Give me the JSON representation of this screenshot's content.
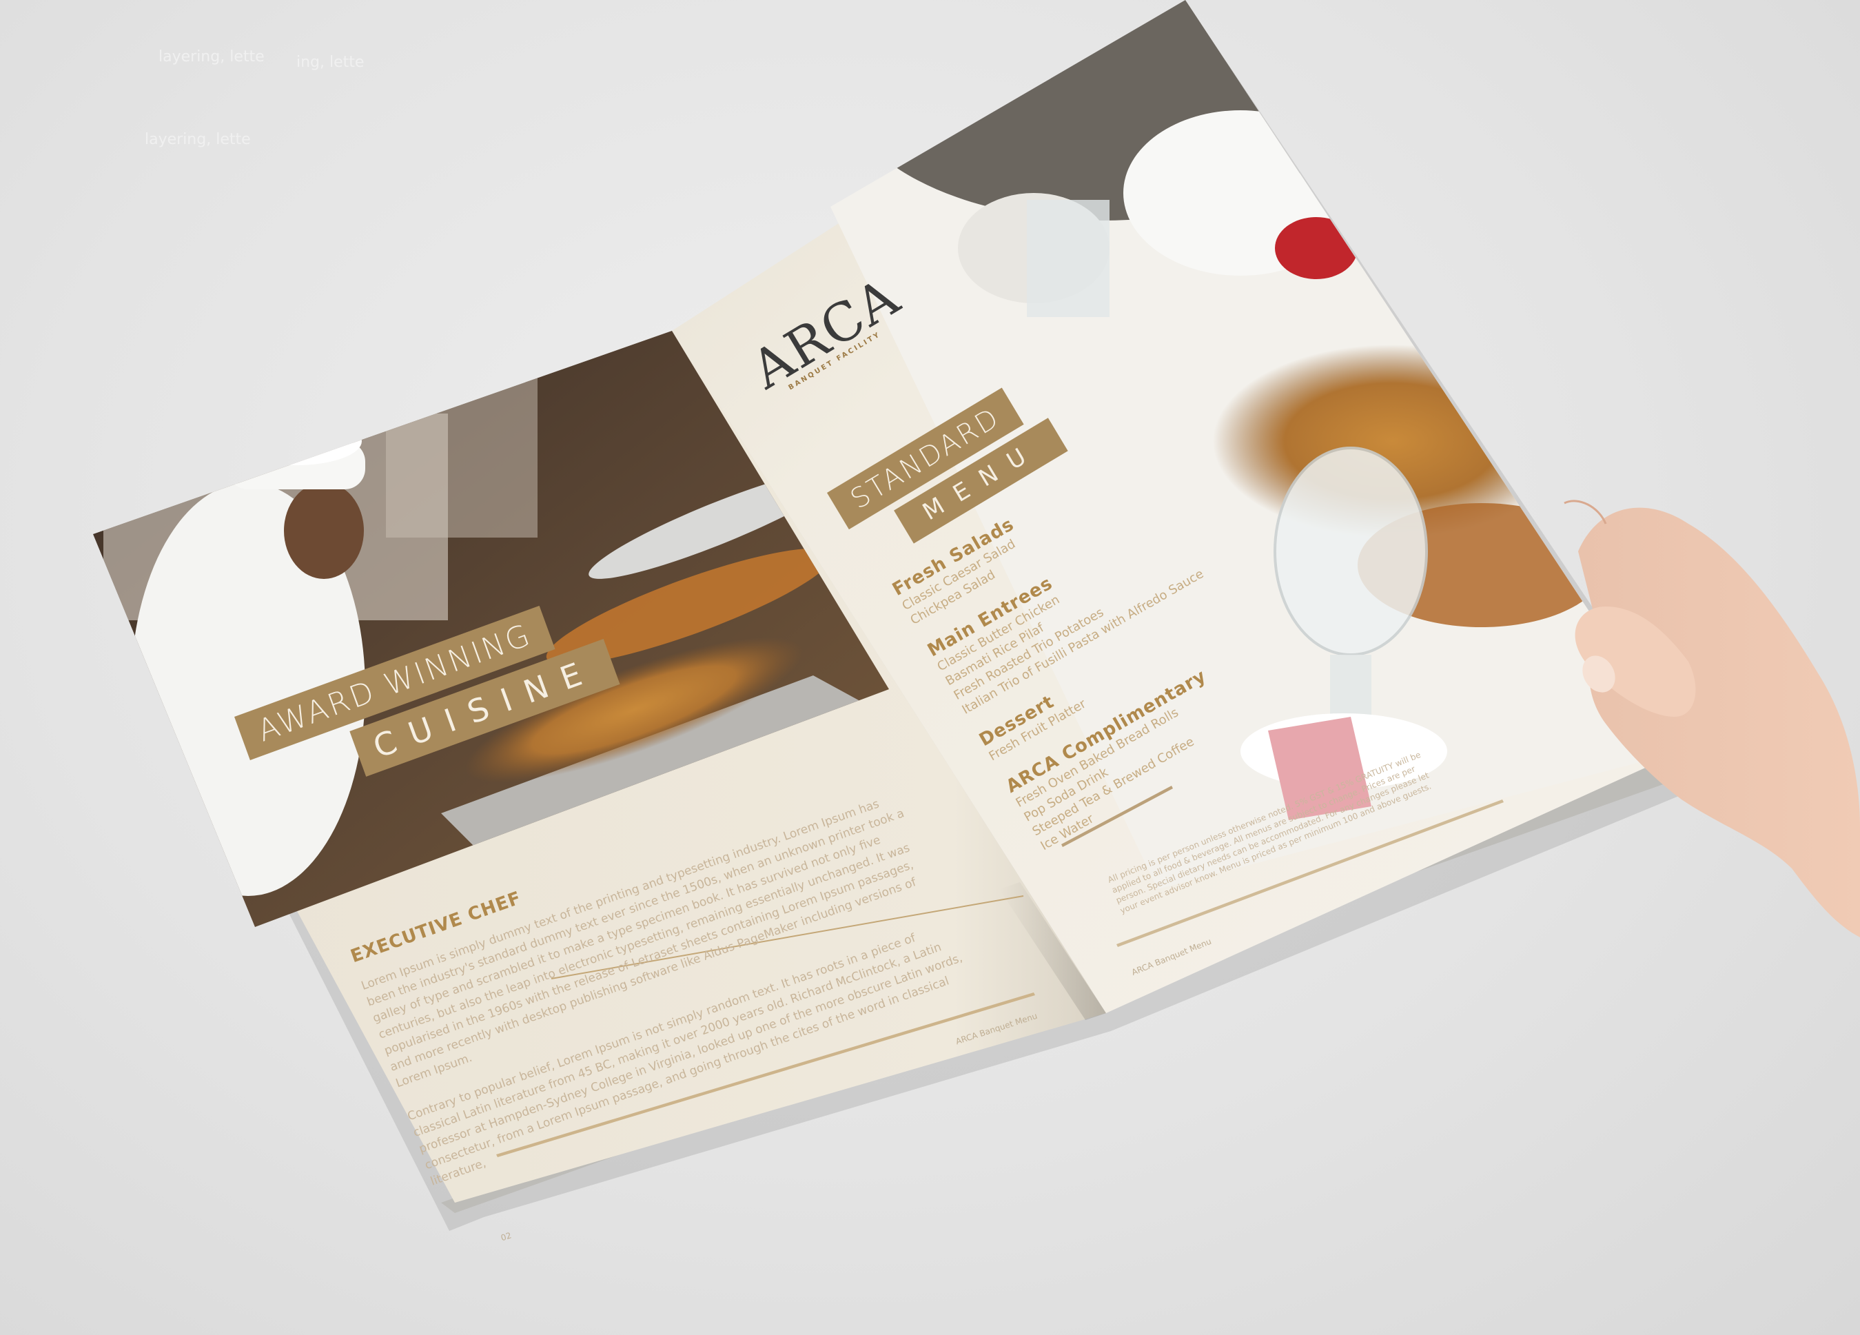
{
  "background_ghost_text": [
    "layering, lette",
    "ing, lette",
    "layering, lette"
  ],
  "left_page": {
    "title_line1": "AWARD WINNING",
    "title_line2": "CUISINE",
    "section_heading": "EXECUTIVE CHEF",
    "paragraph1": "Lorem Ipsum is simply dummy text of the printing and typesetting industry. Lorem Ipsum has been the industry's standard dummy text ever since the 1500s, when an unknown printer took a galley of type and scrambled it to make a type specimen book. It has survived not only five centuries, but also the leap into electronic typesetting, remaining essentially unchanged. It was popularised in the 1960s with the release of Letraset sheets containing Lorem Ipsum passages, and more recently with desktop publishing software like Aldus PageMaker including versions of Lorem Ipsum.",
    "paragraph2": "Contrary to popular belief, Lorem Ipsum is not simply random text. It has roots in a piece of classical Latin literature from 45 BC, making it over 2000 years old. Richard McClintock, a Latin professor at Hampden-Sydney College in Virginia, looked up one of the more obscure Latin words, consectetur, from a Lorem Ipsum passage, and going through the cites of the word in classical literature,",
    "footer": "ARCA Banquet Menu",
    "page_number": "02"
  },
  "right_page": {
    "logo": "ARCA",
    "logo_sub": "BANQUET FACILITY",
    "title_line1": "STANDARD",
    "title_line2": "MENU",
    "sections": [
      {
        "heading": "Fresh Salads",
        "items": [
          "Classic Caesar Salad",
          "Chickpea Salad"
        ]
      },
      {
        "heading": "Main Entrees",
        "items": [
          "Classic Butter Chicken",
          "Basmati Rice Pilaf",
          "Fresh Roasted Trio Potatoes",
          "Italian Trio of Fusilli Pasta with Alfredo Sauce"
        ]
      },
      {
        "heading": "Dessert",
        "items": [
          "Fresh Fruit Platter"
        ]
      },
      {
        "heading": "ARCA Complimentary",
        "items": [
          "Fresh Oven Baked Bread Rolls",
          "Pop Soda Drink",
          "Steeped Tea & Brewed Coffee",
          "Ice Water"
        ]
      }
    ],
    "fine_print": "All pricing is per person unless otherwise noted. 5% GST & 15% GRATUITY will be applied to all food & beverage. All menus are subject to change. Prices are per person. Special dietary needs can be accommodated. For any changes please let your event advisor know. Menu is priced as per minimum 100 and above guests.",
    "footer": "ARCA Banquet Menu"
  },
  "colors": {
    "gold": "#a88a5b",
    "page": "#efe9dc",
    "background": "#e6e6e6"
  }
}
